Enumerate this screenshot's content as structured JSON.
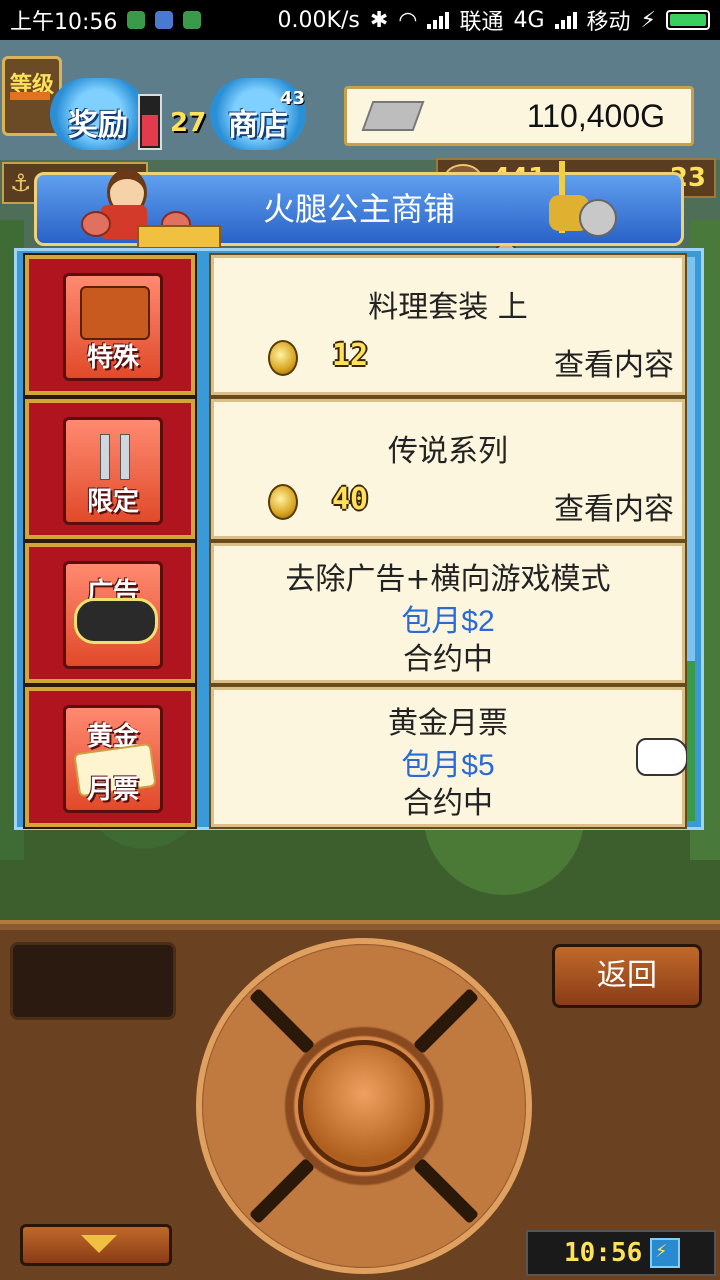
{
  "status_bar": {
    "time": "上午10:56",
    "speed": "0.00K/s",
    "carrier1": "联通",
    "network": "4G",
    "carrier2": "移动"
  },
  "hud": {
    "rank_label": "等级",
    "reward_label": "奖励",
    "shop_label": "商店",
    "level_value": "27",
    "top_small": "43",
    "gold": "110,400G",
    "anchor_status": "停泊中",
    "resource1": "441",
    "resource2": "23"
  },
  "shop": {
    "title": "火腿公主商铺",
    "rows": [
      {
        "category": "特殊",
        "name": "料理套装 上",
        "price": "12",
        "action": "查看内容"
      },
      {
        "category": "限定",
        "name": "传说系列",
        "price": "40",
        "action": "查看内容"
      },
      {
        "category": "广告",
        "name": "去除广告+横向游戏模式",
        "price": "包月$2",
        "status": "合约中"
      },
      {
        "category_top": "黄金",
        "category_bottom": "月票",
        "name": "黄金月票",
        "price": "包月$5",
        "status": "合约中"
      }
    ]
  },
  "controller": {
    "back_label": "返回",
    "clock": "10:56"
  },
  "icons": {
    "silver": "silver-bar-icon",
    "coin": "gold-coin-icon",
    "hand": "pointing-hand-icon"
  }
}
